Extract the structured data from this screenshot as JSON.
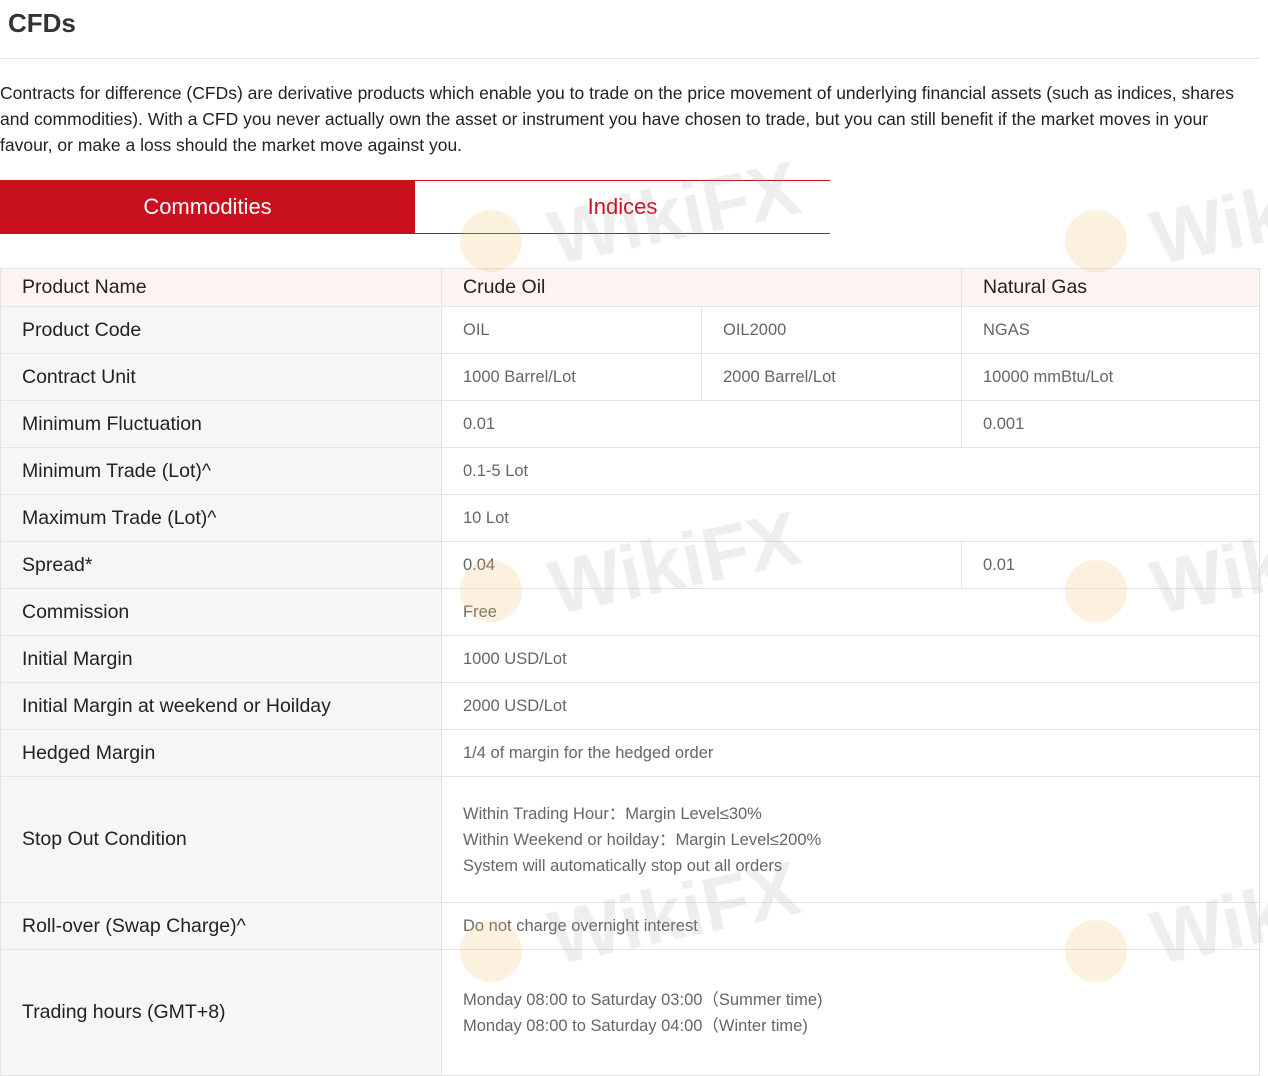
{
  "page": {
    "title": "CFDs",
    "intro": "Contracts for difference (CFDs) are derivative products which enable you to trade on the price movement of underlying financial assets (such as indices, shares and commodities). With a CFD you never actually own the asset or instrument you have chosen to trade, but you can still benefit if the market moves in your favour, or make a loss should the market move against you."
  },
  "tabs": [
    {
      "label": "Commodities",
      "active": true
    },
    {
      "label": "Indices",
      "active": false
    }
  ],
  "table": {
    "header": {
      "label": "Product Name",
      "crude": "Crude Oil",
      "gas": "Natural Gas"
    },
    "product_code": {
      "label": "Product Code",
      "values": [
        "OIL",
        "OIL2000",
        "NGAS"
      ]
    },
    "contract_unit": {
      "label": "Contract Unit",
      "values": [
        "1000 Barrel/Lot",
        "2000 Barrel/Lot",
        "10000 mmBtu/Lot"
      ]
    },
    "min_fluctuation": {
      "label": "Minimum Fluctuation",
      "values": [
        "0.01",
        "0.001"
      ]
    },
    "min_trade": {
      "label": "Minimum Trade (Lot)^",
      "value": "0.1-5 Lot"
    },
    "max_trade": {
      "label": "Maximum Trade (Lot)^",
      "value": "10 Lot"
    },
    "spread": {
      "label": "Spread*",
      "values": [
        "0.04",
        "0.01"
      ]
    },
    "commission": {
      "label": "Commission",
      "value": "Free"
    },
    "initial_margin": {
      "label": "Initial Margin",
      "value": "1000 USD/Lot"
    },
    "initial_margin_weekend": {
      "label": "Initial Margin at weekend or Hoilday",
      "value": "2000 USD/Lot"
    },
    "hedged_margin": {
      "label": "Hedged Margin",
      "value": "1/4 of margin for the hedged order"
    },
    "stop_out": {
      "label": "Stop Out Condition",
      "lines": [
        "Within Trading Hour：Margin Level≤30%",
        "Within Weekend or hoilday：Margin Level≤200%",
        "System will automatically stop out all orders"
      ]
    },
    "rollover": {
      "label": "Roll-over (Swap Charge)^",
      "value": "Do not charge overnight interest"
    },
    "trading_hours": {
      "label": "Trading hours (GMT+8)",
      "lines": [
        "Monday 08:00 to Saturday 03:00（Summer time)",
        "Monday 08:00 to Saturday 04:00（Winter time)"
      ]
    }
  },
  "watermark": {
    "text": "WikiFX"
  }
}
